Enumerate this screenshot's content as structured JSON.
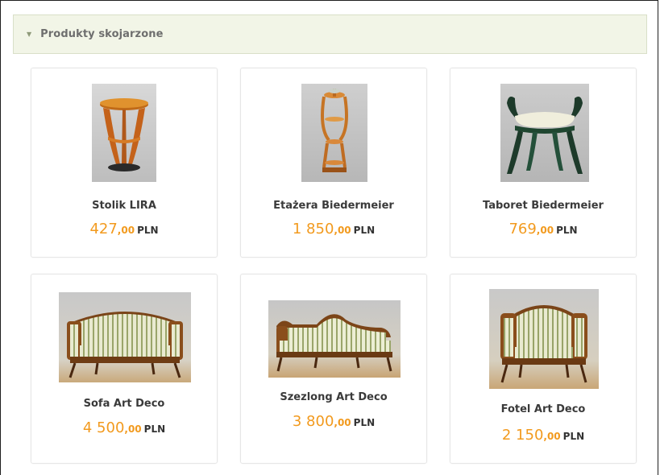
{
  "section": {
    "title": "Produkty skojarzone"
  },
  "products": [
    {
      "name": "Stolik LIRA",
      "price_int": "427",
      "price_dec": ",00",
      "currency": "PLN"
    },
    {
      "name": "Etażera Biedermeier",
      "price_int": "1 850",
      "price_dec": ",00",
      "currency": "PLN"
    },
    {
      "name": "Taboret Biedermeier",
      "price_int": "769",
      "price_dec": ",00",
      "currency": "PLN"
    },
    {
      "name": "Sofa Art Deco",
      "price_int": "4 500",
      "price_dec": ",00",
      "currency": "PLN"
    },
    {
      "name": "Szezlong Art Deco",
      "price_int": "3 800",
      "price_dec": ",00",
      "currency": "PLN"
    },
    {
      "name": "Fotel Art Deco",
      "price_int": "2 150",
      "price_dec": ",00",
      "currency": "PLN"
    }
  ],
  "colors": {
    "price": "#f29a1e",
    "header_bg": "#f2f5e7"
  },
  "icons": {
    "header": "chevron-down-icon"
  }
}
